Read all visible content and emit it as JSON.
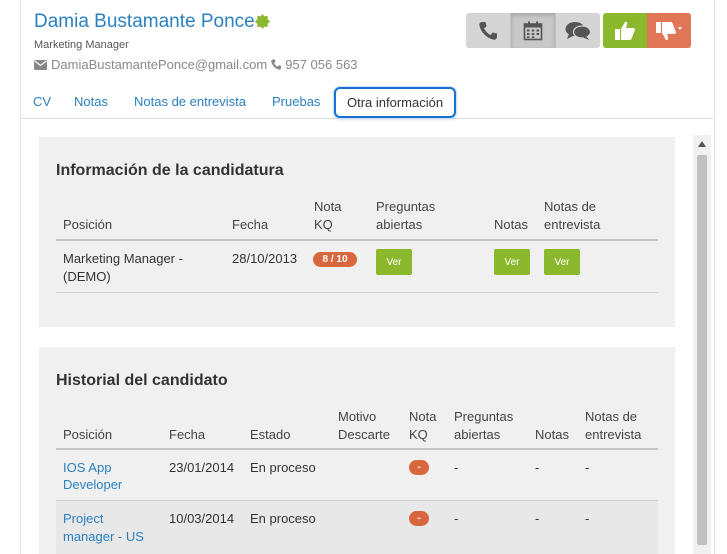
{
  "candidate": {
    "name": "Damia Bustamante Ponce",
    "role": "Marketing Manager",
    "email": "DamiaBustamantePonce@gmail.com",
    "phone": "957 056 563"
  },
  "actions": {
    "call_icon": "phone-icon",
    "calendar_icon": "calendar-icon",
    "chat_icon": "chat-icon",
    "like_icon": "thumbs-up-icon",
    "dislike_icon": "thumbs-down-icon"
  },
  "tabs": [
    {
      "label": "CV"
    },
    {
      "label": "Notas"
    },
    {
      "label": "Notas de entrevista"
    },
    {
      "label": "Pruebas"
    },
    {
      "label": "Otra información",
      "active": true
    }
  ],
  "candidatura": {
    "title": "Información de la candidatura",
    "headers": {
      "posicion": "Posición",
      "fecha": "Fecha",
      "nota_kq_1": "Nota",
      "nota_kq_2": "KQ",
      "preguntas_1": "Preguntas",
      "preguntas_2": "abiertas",
      "notas": "Notas",
      "notas_ent_1": "Notas de",
      "notas_ent_2": "entrevista"
    },
    "rows": [
      {
        "posicion_1": "Marketing Manager -",
        "posicion_2": "(DEMO)",
        "fecha": "28/10/2013",
        "nota_kq": "8 / 10",
        "preguntas": "Ver",
        "notas": "Ver",
        "notas_entrevista": "Ver"
      }
    ]
  },
  "historial": {
    "title": "Historial del candidato",
    "headers": {
      "posicion": "Posición",
      "fecha": "Fecha",
      "estado": "Estado",
      "motivo_1": "Motivo",
      "motivo_2": "Descarte",
      "nota_kq_1": "Nota",
      "nota_kq_2": "KQ",
      "preguntas_1": "Preguntas",
      "preguntas_2": "abiertas",
      "notas": "Notas",
      "notas_ent_1": "Notas de",
      "notas_ent_2": "entrevista"
    },
    "rows": [
      {
        "posicion_1": "IOS App",
        "posicion_2": "Developer",
        "fecha": "23/01/2014",
        "estado": "En proceso",
        "nota_kq": "-",
        "preguntas": "-",
        "notas": "-",
        "notas_entrevista": "-"
      },
      {
        "posicion_1": "Project",
        "posicion_2": "manager - US",
        "fecha": "10/03/2014",
        "estado": "En proceso",
        "nota_kq": "-",
        "preguntas": "-",
        "notas": "-",
        "notas_entrevista": "-"
      }
    ]
  },
  "colors": {
    "link": "#2b80c1",
    "accent_green": "#8cb82e",
    "accent_orange": "#e07656",
    "kq_badge": "#d9673e",
    "active_tab_border": "#1a6fd3"
  }
}
